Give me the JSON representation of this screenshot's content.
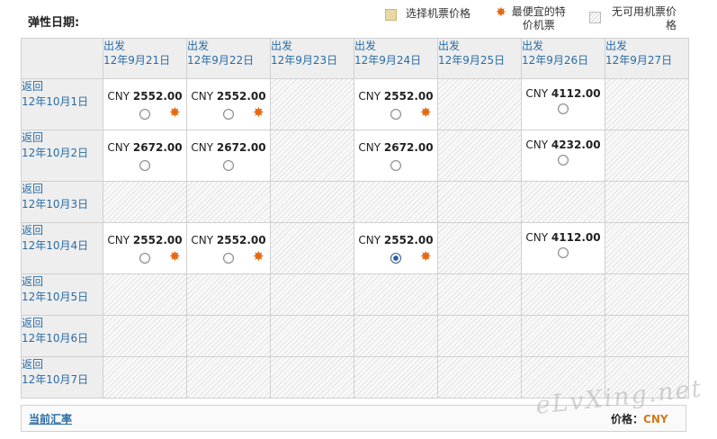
{
  "header": {
    "title": "弹性日期:"
  },
  "legend": {
    "selected": "选择机票价格",
    "cheapest": [
      "最便宜的特",
      "价机票"
    ],
    "unavailable": [
      "无可用机票价",
      "格"
    ]
  },
  "grid": {
    "departures": [
      {
        "label": "出发",
        "date": "12年9月21日"
      },
      {
        "label": "出发",
        "date": "12年9月22日"
      },
      {
        "label": "出发",
        "date": "12年9月23日"
      },
      {
        "label": "出发",
        "date": "12年9月24日"
      },
      {
        "label": "出发",
        "date": "12年9月25日"
      },
      {
        "label": "出发",
        "date": "12年9月26日"
      },
      {
        "label": "出发",
        "date": "12年9月27日"
      }
    ],
    "returns": [
      {
        "label": "返回",
        "date": "12年10月1日",
        "cells": [
          {
            "currency": "CNY",
            "amount": "2552.00",
            "cheapest": true
          },
          {
            "currency": "CNY",
            "amount": "2552.00",
            "cheapest": true
          },
          null,
          {
            "currency": "CNY",
            "amount": "2552.00",
            "cheapest": true
          },
          null,
          {
            "currency": "CNY",
            "amount": "4112.00",
            "cheapest": false
          },
          null
        ]
      },
      {
        "label": "返回",
        "date": "12年10月2日",
        "cells": [
          {
            "currency": "CNY",
            "amount": "2672.00",
            "cheapest": false
          },
          {
            "currency": "CNY",
            "amount": "2672.00",
            "cheapest": false
          },
          null,
          {
            "currency": "CNY",
            "amount": "2672.00",
            "cheapest": false
          },
          null,
          {
            "currency": "CNY",
            "amount": "4232.00",
            "cheapest": false
          },
          null
        ]
      },
      {
        "label": "返回",
        "date": "12年10月3日",
        "cells": [
          null,
          null,
          null,
          null,
          null,
          null,
          null
        ]
      },
      {
        "label": "返回",
        "date": "12年10月4日",
        "cells": [
          {
            "currency": "CNY",
            "amount": "2552.00",
            "cheapest": true
          },
          {
            "currency": "CNY",
            "amount": "2552.00",
            "cheapest": true
          },
          null,
          {
            "currency": "CNY",
            "amount": "2552.00",
            "cheapest": true,
            "selected": true
          },
          null,
          {
            "currency": "CNY",
            "amount": "4112.00",
            "cheapest": false
          },
          null
        ]
      },
      {
        "label": "返回",
        "date": "12年10月5日",
        "cells": [
          null,
          null,
          null,
          null,
          null,
          null,
          null
        ]
      },
      {
        "label": "返回",
        "date": "12年10月6日",
        "cells": [
          null,
          null,
          null,
          null,
          null,
          null,
          null
        ]
      },
      {
        "label": "返回",
        "date": "12年10月7日",
        "cells": [
          null,
          null,
          null,
          null,
          null,
          null,
          null
        ]
      }
    ]
  },
  "footer": {
    "rate_link": "当前汇率",
    "price_label": "价格：",
    "price_currency": "CNY"
  },
  "watermark": "eLvXing.net",
  "colors": {
    "link": "#2a6ca5",
    "star": "#e36a12",
    "currency": "#d27a1c"
  }
}
